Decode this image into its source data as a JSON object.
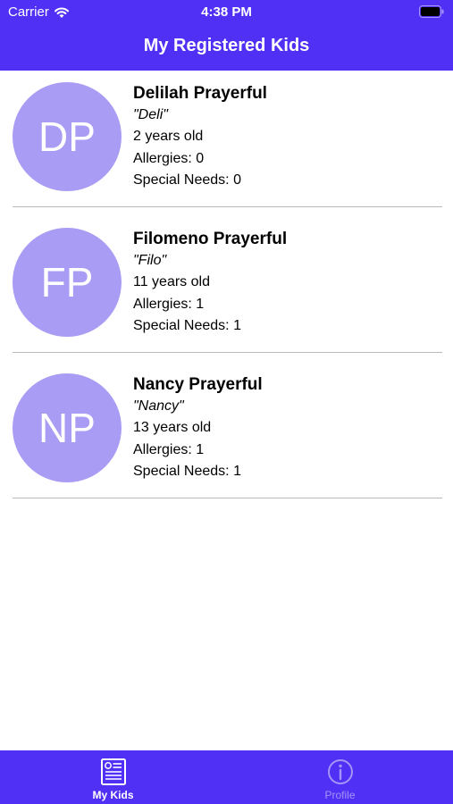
{
  "status_bar": {
    "carrier": "Carrier",
    "time": "4:38 PM"
  },
  "header": {
    "title": "My Registered Kids",
    "background_color": "#5030f5"
  },
  "kids": [
    {
      "initials": "DP",
      "name": "Delilah Prayerful",
      "nickname": "\"Deli\"",
      "age": "2 years old",
      "allergies": "Allergies: 0",
      "special_needs": "Special Needs: 0"
    },
    {
      "initials": "FP",
      "name": "Filomeno Prayerful",
      "nickname": "\"Filo\"",
      "age": "11 years old",
      "allergies": "Allergies: 1",
      "special_needs": "Special Needs: 1"
    },
    {
      "initials": "NP",
      "name": "Nancy Prayerful",
      "nickname": "\"Nancy\"",
      "age": "13 years old",
      "allergies": "Allergies: 1",
      "special_needs": "Special Needs: 1"
    }
  ],
  "tab_bar": {
    "tabs": [
      {
        "label": "My Kids",
        "icon": "newspaper-icon",
        "active": true
      },
      {
        "label": "Profile",
        "icon": "info-icon",
        "active": false
      }
    ]
  },
  "colors": {
    "accent": "#5030f5",
    "avatar": "#a99cf4",
    "inactive_tab": "#a494f7"
  }
}
